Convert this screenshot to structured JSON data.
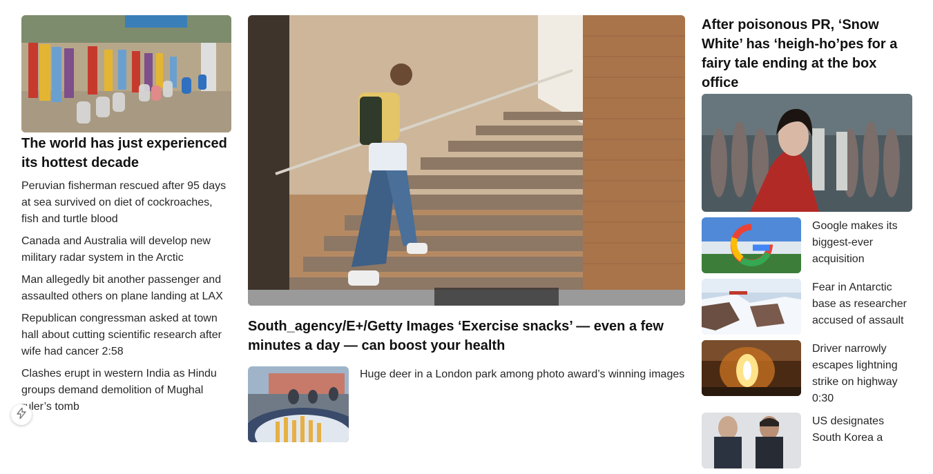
{
  "left": {
    "headline": "The world has just experienced its hottest decade",
    "links": [
      "Peruvian fisherman rescued after 95 days at sea survived on diet of cockroaches, fish and turtle blood",
      "Canada and Australia will develop new military radar system in the Arctic",
      "Man allegedly bit another passenger and assaulted others on plane landing at LAX",
      "Republican congressman asked at town hall about cutting scientific research after wife had cancer 2:58",
      "Clashes erupt in western India as Hindu groups demand demolition of Mughal ruler’s tomb"
    ]
  },
  "middle": {
    "headline": "South_agency/E+/Getty Images ‘Exercise snacks’ — even a few minutes a day — can boost your health",
    "sub_story": "Huge deer in a London park among photo award’s winning images"
  },
  "right": {
    "headline": "After poisonous PR, ‘Snow White’ has ‘heigh-ho’pes for a fairy tale ending at the box office",
    "thumbs": [
      {
        "text": "Google makes its biggest-ever acquisition"
      },
      {
        "text": "Fear in Antarctic base as researcher accused of assault"
      },
      {
        "text": "Driver narrowly escapes lightning strike on highway 0:30"
      },
      {
        "text": "US designates South Korea a"
      }
    ]
  },
  "icons": {
    "fab": "lightning-icon"
  }
}
